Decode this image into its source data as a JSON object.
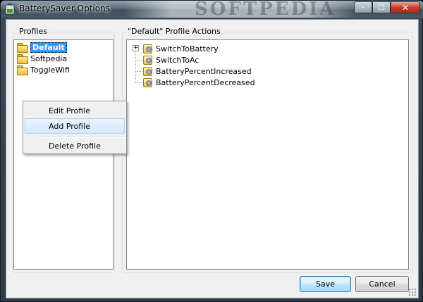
{
  "window": {
    "title": "BatterySaver Options",
    "watermark": "SOFTPEDIA",
    "minimize_glyph": "–",
    "maximize_glyph": "□",
    "close_glyph": "✕"
  },
  "profiles": {
    "label": "Profiles",
    "items": [
      {
        "label": "Default",
        "selected": true
      },
      {
        "label": "Softpedia",
        "selected": false
      },
      {
        "label": "ToggleWifi",
        "selected": false
      }
    ]
  },
  "actions": {
    "label": "\"Default\" Profile Actions",
    "items": [
      {
        "label": "SwitchToBattery",
        "expandable": true,
        "expander": "+"
      },
      {
        "label": "SwitchToAc",
        "expandable": false
      },
      {
        "label": "BatteryPercentIncreased",
        "expandable": false
      },
      {
        "label": "BatteryPercentDecreased",
        "expandable": false
      }
    ]
  },
  "context_menu": {
    "items": [
      {
        "label": "Edit Profile",
        "hovered": false
      },
      {
        "label": "Add Profile",
        "hovered": true
      },
      {
        "label": "Delete Profile",
        "hovered": false
      }
    ]
  },
  "buttons": {
    "save_label": "Save",
    "cancel_label": "Cancel"
  },
  "icons": {
    "title": "battery-icon",
    "profile": "folder-icon",
    "action": "action-script-icon"
  },
  "colors": {
    "selection": "#3399ff",
    "menu_hover": "#d6e8fb",
    "default_button_border": "#3c7fb1"
  }
}
